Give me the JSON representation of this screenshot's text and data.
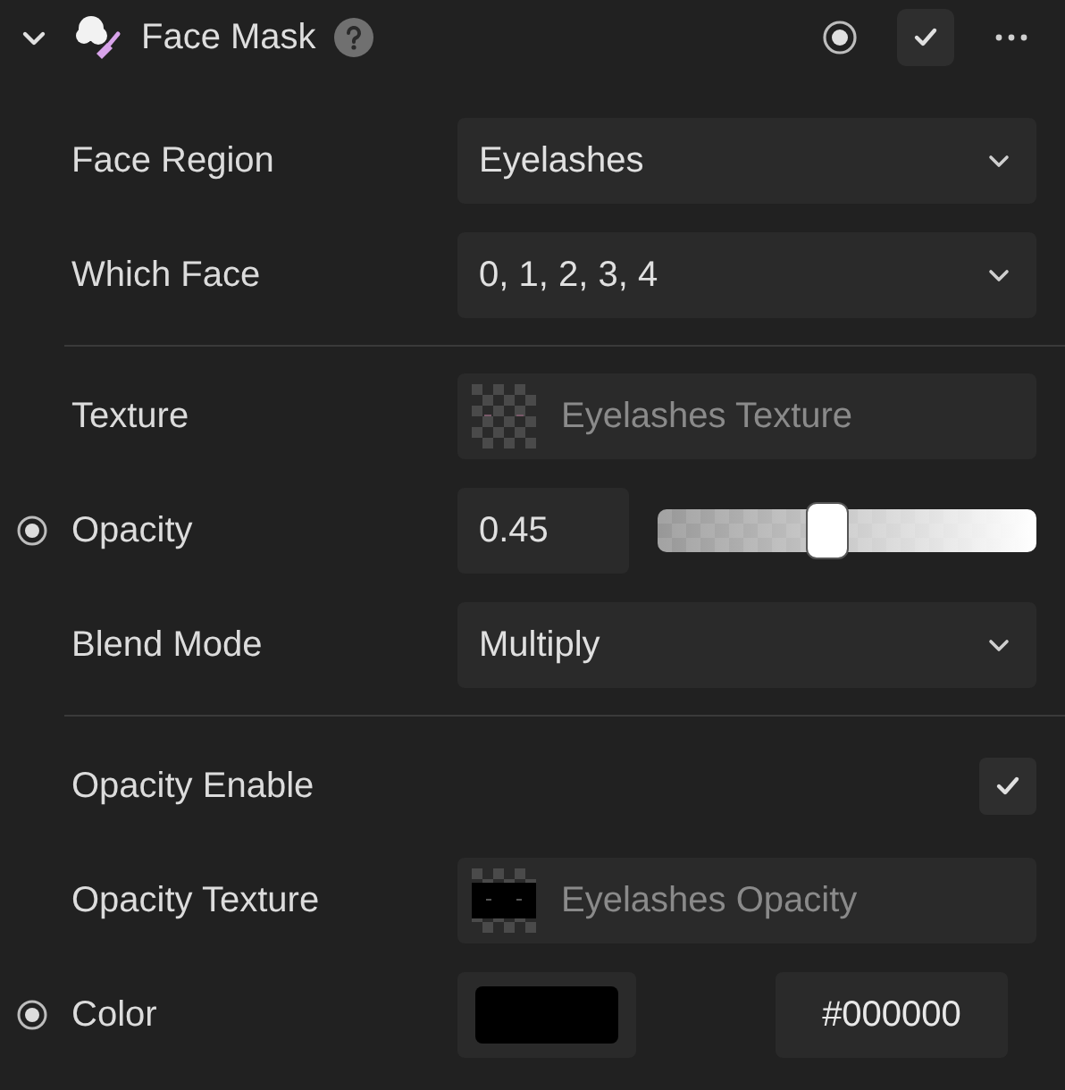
{
  "header": {
    "title": "Face Mask",
    "expanded": true,
    "enabled": true
  },
  "sections": [
    [
      {
        "kind": "dropdown",
        "label": "Face Region",
        "value": "Eyelashes",
        "keyframe": false
      },
      {
        "kind": "dropdown",
        "label": "Which Face",
        "value": "0, 1, 2, 3, 4",
        "keyframe": false
      }
    ],
    [
      {
        "kind": "texture",
        "label": "Texture",
        "value": "Eyelashes Texture",
        "keyframe": false
      },
      {
        "kind": "slider",
        "label": "Opacity",
        "value": "0.45",
        "level": 0.45,
        "keyframe": true
      },
      {
        "kind": "dropdown",
        "label": "Blend Mode",
        "value": "Multiply",
        "keyframe": false
      }
    ],
    [
      {
        "kind": "checkbox",
        "label": "Opacity Enable",
        "checked": true,
        "keyframe": false
      },
      {
        "kind": "texture",
        "label": "Opacity Texture",
        "value": "Eyelashes Opacity",
        "keyframe": false
      },
      {
        "kind": "color",
        "label": "Color",
        "color": "#000000",
        "value": "#000000",
        "keyframe": true
      }
    ]
  ]
}
